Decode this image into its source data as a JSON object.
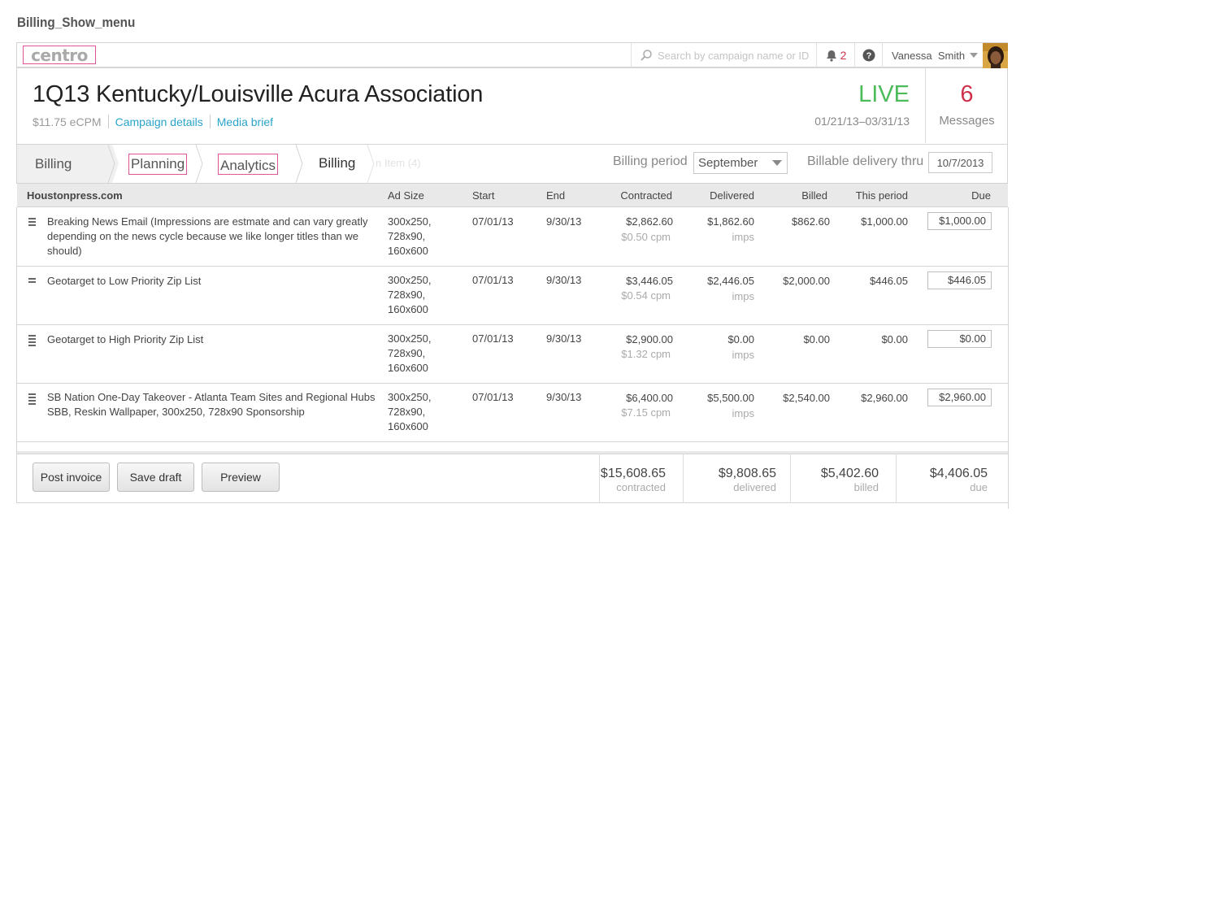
{
  "page_label": "Billing_Show_menu",
  "topbar": {
    "logo": "centro",
    "search_placeholder": "Search by campaign name or ID",
    "notification_count": "2",
    "user_name": "Vanessa  Smith"
  },
  "header": {
    "title": "1Q13 Kentucky/Louisville Acura Association",
    "ecpm": "$11.75 eCPM",
    "campaign_details": "Campaign details",
    "media_brief": "Media brief",
    "status": "LIVE",
    "dates": "01/21/13–03/31/13",
    "messages_count": "6",
    "messages_label": "Messages"
  },
  "breadcrumbs": {
    "items": [
      "Billing",
      "Planning",
      "Analytics",
      "Billing"
    ],
    "faded": "n Item (4)"
  },
  "billing_controls": {
    "period_label": "Billing period",
    "period_value": "September",
    "delivery_label": "Billable delivery thru",
    "delivery_value": "10/7/2013"
  },
  "table": {
    "columns": {
      "site": "Houstonpress.com",
      "ad_size": "Ad Size",
      "start": "Start",
      "end": "End",
      "contracted": "Contracted",
      "delivered": "Delivered",
      "billed": "Billed",
      "this_period": "This period",
      "due": "Due"
    },
    "rows": [
      {
        "name": "Breaking News Email (Impressions are estmate and can vary  greatly depending on the news cycle because we like longer titles than we should)",
        "ad_size": "300x250, 728x90, 160x600",
        "start": "07/01/13",
        "end": "9/30/13",
        "contracted": "$2,862.60",
        "cpm": "$0.50 cpm",
        "delivered": "$1,862.60",
        "imps": "imps",
        "billed": "$862.60",
        "this_period": "$1,000.00",
        "due": "$1,000.00"
      },
      {
        "name": "Geotarget to Low Priority Zip List",
        "ad_size": "300x250, 728x90, 160x600",
        "start": "07/01/13",
        "end": "9/30/13",
        "contracted": "$3,446.05",
        "cpm": "$0.54 cpm",
        "delivered": "$2,446.05",
        "imps": "imps",
        "billed": "$2,000.00",
        "this_period": "$446.05",
        "due": "$446.05"
      },
      {
        "name": "Geotarget to High Priority Zip List",
        "ad_size": "300x250, 728x90, 160x600",
        "start": "07/01/13",
        "end": "9/30/13",
        "contracted": "$2,900.00",
        "cpm": "$1.32 cpm",
        "delivered": "$0.00",
        "imps": "imps",
        "billed": "$0.00",
        "this_period": "$0.00",
        "due": "$0.00"
      },
      {
        "name": "SB Nation One-Day Takeover - Atlanta Team Sites and Regional Hubs SBB, Reskin Wallpaper, 300x250, 728x90 Sponsorship",
        "ad_size": "300x250, 728x90, 160x600",
        "start": "07/01/13",
        "end": "9/30/13",
        "contracted": "$6,400.00",
        "cpm": "$7.15 cpm",
        "delivered": "$5,500.00",
        "imps": "imps",
        "billed": "$2,540.00",
        "this_period": "$2,960.00",
        "due": "$2,960.00"
      }
    ]
  },
  "footer": {
    "post_invoice": "Post invoice",
    "save_draft": "Save draft",
    "preview": "Preview",
    "totals": {
      "contracted": "$15,608.65",
      "contracted_label": "contracted",
      "delivered": "$9,808.65",
      "delivered_label": "delivered",
      "billed": "$5,402.60",
      "billed_label": "billed",
      "due": "$4,406.05",
      "due_label": "due"
    }
  },
  "colors": {
    "accent_link": "#2aa3c9",
    "live_green": "#4cbb5a",
    "alert_red": "#d0304a",
    "annotation_pink": "#e0559a"
  }
}
